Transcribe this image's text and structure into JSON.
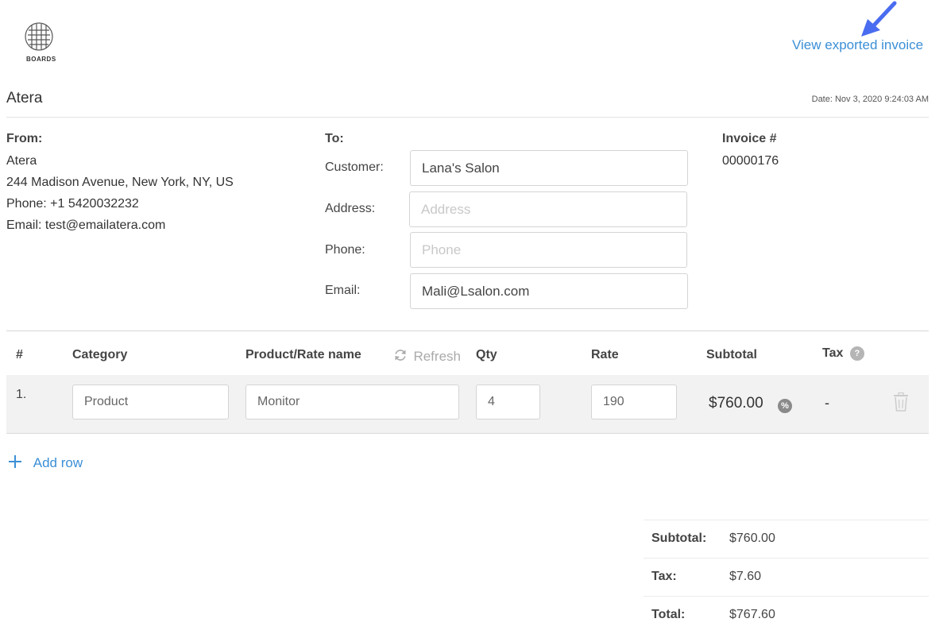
{
  "header": {
    "logo_text": "BOARDS",
    "export_link": "View exported invoice",
    "company_name": "Atera",
    "date": "Date: Nov 3, 2020 9:24:03 AM"
  },
  "from": {
    "label": "From:",
    "lines": [
      "Atera",
      "244 Madison Avenue, New York, NY, US",
      "Phone: +1 5420032232",
      "Email: test@emailatera.com"
    ]
  },
  "to": {
    "label": "To:",
    "customer_label": "Customer:",
    "customer_value": "Lana's Salon",
    "address_label": "Address:",
    "address_placeholder": "Address",
    "phone_label": "Phone:",
    "phone_placeholder": "Phone",
    "email_label": "Email:",
    "email_value": "Mali@Lsalon.com"
  },
  "invoice": {
    "label": "Invoice #",
    "number": "00000176"
  },
  "table": {
    "headers": {
      "index": "#",
      "category": "Category",
      "product": "Product/Rate name",
      "refresh": "Refresh",
      "qty": "Qty",
      "rate": "Rate",
      "subtotal": "Subtotal",
      "tax": "Tax",
      "tax_help": "?"
    },
    "rows": [
      {
        "index": "1.",
        "category": "Product",
        "product": "Monitor",
        "qty": "4",
        "rate": "190",
        "subtotal": "$760.00",
        "discount_badge": "%",
        "tax": "-"
      }
    ],
    "add_row": "Add row"
  },
  "summary": {
    "subtotal_label": "Subtotal:",
    "subtotal_value": "$760.00",
    "tax_label": "Tax:",
    "tax_value": "$7.60",
    "total_label": "Total:",
    "total_value": "$767.60"
  },
  "colors": {
    "link": "#3b8fd6",
    "arrow": "#4a6cf0",
    "row_bg": "#f2f2f2"
  },
  "icons": [
    "logo-icon",
    "arrow-annotation-icon",
    "refresh-icon",
    "help-icon",
    "percent-icon",
    "trash-icon",
    "plus-icon"
  ]
}
